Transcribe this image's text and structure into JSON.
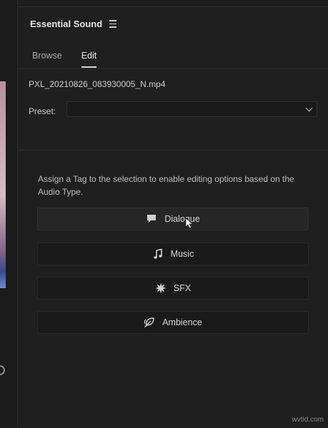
{
  "panel": {
    "title": "Essential Sound",
    "tabs": [
      {
        "label": "Browse",
        "active": false
      },
      {
        "label": "Edit",
        "active": true
      }
    ],
    "clip_name": "PXL_20210826_083930005_N.mp4",
    "preset": {
      "label": "Preset:",
      "value": ""
    },
    "instructions": "Assign a Tag to the selection to enable editing options based on the Audio Type.",
    "tags": [
      {
        "label": "Dialogue",
        "icon": "speech-bubble-icon"
      },
      {
        "label": "Music",
        "icon": "music-note-icon"
      },
      {
        "label": "SFX",
        "icon": "starburst-icon"
      },
      {
        "label": "Ambience",
        "icon": "leaf-icon"
      }
    ]
  },
  "watermark": "wvtid.com",
  "colors": {
    "background": "#1f1f1f",
    "button": "#1a1a1a",
    "text": "#d6d6d6"
  }
}
